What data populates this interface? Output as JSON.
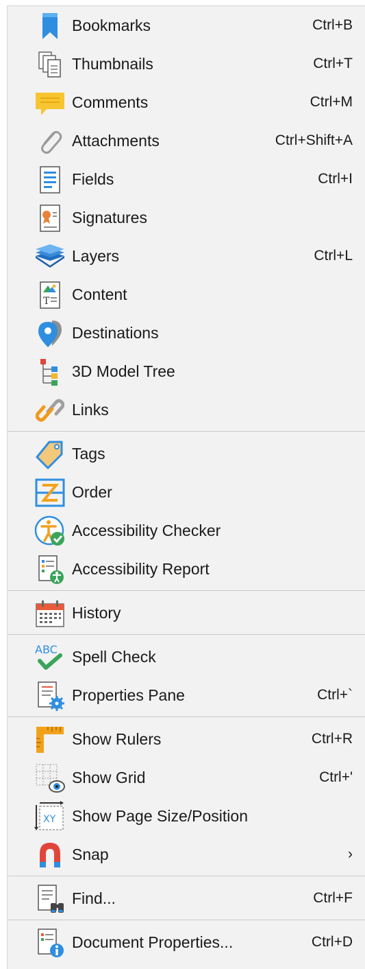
{
  "colors": {
    "menu_bg": "#f2f2f2",
    "separator": "#c9c9c9",
    "text": "#1a1a1a"
  },
  "groups": [
    {
      "items": [
        {
          "label": "Bookmarks",
          "shortcut": "Ctrl+B",
          "icon": "bookmark-icon"
        },
        {
          "label": "Thumbnails",
          "shortcut": "Ctrl+T",
          "icon": "thumbnails-icon"
        },
        {
          "label": "Comments",
          "shortcut": "Ctrl+M",
          "icon": "comment-icon"
        },
        {
          "label": "Attachments",
          "shortcut": "Ctrl+Shift+A",
          "icon": "paperclip-icon"
        },
        {
          "label": "Fields",
          "shortcut": "Ctrl+I",
          "icon": "fields-icon"
        },
        {
          "label": "Signatures",
          "shortcut": "",
          "icon": "signature-icon"
        },
        {
          "label": "Layers",
          "shortcut": "Ctrl+L",
          "icon": "layers-icon"
        },
        {
          "label": "Content",
          "shortcut": "",
          "icon": "content-icon"
        },
        {
          "label": "Destinations",
          "shortcut": "",
          "icon": "destination-pin-icon"
        },
        {
          "label": "3D Model Tree",
          "shortcut": "",
          "icon": "model-tree-icon"
        },
        {
          "label": "Links",
          "shortcut": "",
          "icon": "link-icon"
        }
      ]
    },
    {
      "items": [
        {
          "label": "Tags",
          "shortcut": "",
          "icon": "tag-icon"
        },
        {
          "label": "Order",
          "shortcut": "",
          "icon": "order-icon"
        },
        {
          "label": "Accessibility Checker",
          "shortcut": "",
          "icon": "accessibility-checker-icon"
        },
        {
          "label": "Accessibility Report",
          "shortcut": "",
          "icon": "accessibility-report-icon"
        }
      ]
    },
    {
      "items": [
        {
          "label": "History",
          "shortcut": "",
          "icon": "calendar-icon"
        }
      ]
    },
    {
      "items": [
        {
          "label": "Spell Check",
          "shortcut": "",
          "icon": "spell-check-icon"
        },
        {
          "label": "Properties Pane",
          "shortcut": "Ctrl+`",
          "icon": "properties-icon"
        }
      ]
    },
    {
      "items": [
        {
          "label": "Show Rulers",
          "shortcut": "Ctrl+R",
          "icon": "ruler-icon"
        },
        {
          "label": "Show Grid",
          "shortcut": "Ctrl+'",
          "icon": "grid-icon"
        },
        {
          "label": "Show Page Size/Position",
          "shortcut": "",
          "icon": "page-size-icon"
        },
        {
          "label": "Snap",
          "shortcut": "›",
          "icon": "magnet-icon"
        }
      ]
    },
    {
      "items": [
        {
          "label": "Find...",
          "shortcut": "Ctrl+F",
          "icon": "find-icon"
        }
      ]
    },
    {
      "items": [
        {
          "label": "Document Properties...",
          "shortcut": "Ctrl+D",
          "icon": "document-info-icon"
        }
      ]
    }
  ]
}
